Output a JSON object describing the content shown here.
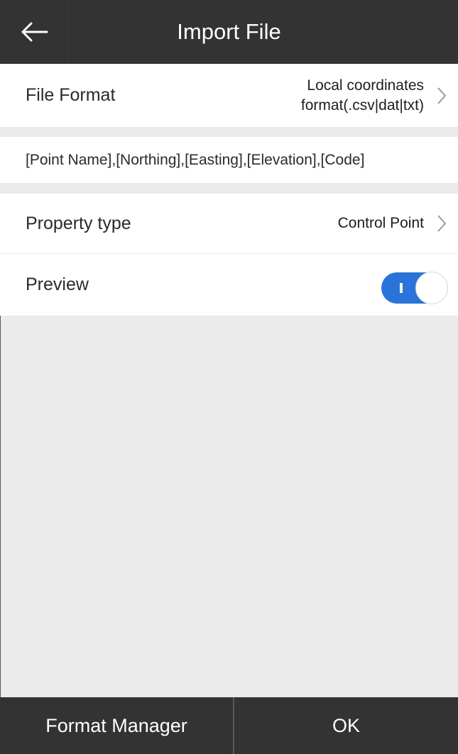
{
  "header": {
    "title": "Import File",
    "back_icon": "arrow-left-icon"
  },
  "file_format": {
    "label": "File Format",
    "value_line1": "Local coordinates",
    "value_line2": "format(.csv|dat|txt)",
    "icon": "chevron-right-icon"
  },
  "format_string": "[Point Name],[Northing],[Easting],[Elevation],[Code]",
  "property_type": {
    "label": "Property type",
    "value": "Control Point",
    "icon": "chevron-right-icon"
  },
  "preview": {
    "label": "Preview",
    "enabled": true
  },
  "footer": {
    "left_label": "Format Manager",
    "right_label": "OK"
  },
  "colors": {
    "header_bg": "#333333",
    "toggle_on": "#2a73d9",
    "page_bg": "#ebebeb"
  }
}
